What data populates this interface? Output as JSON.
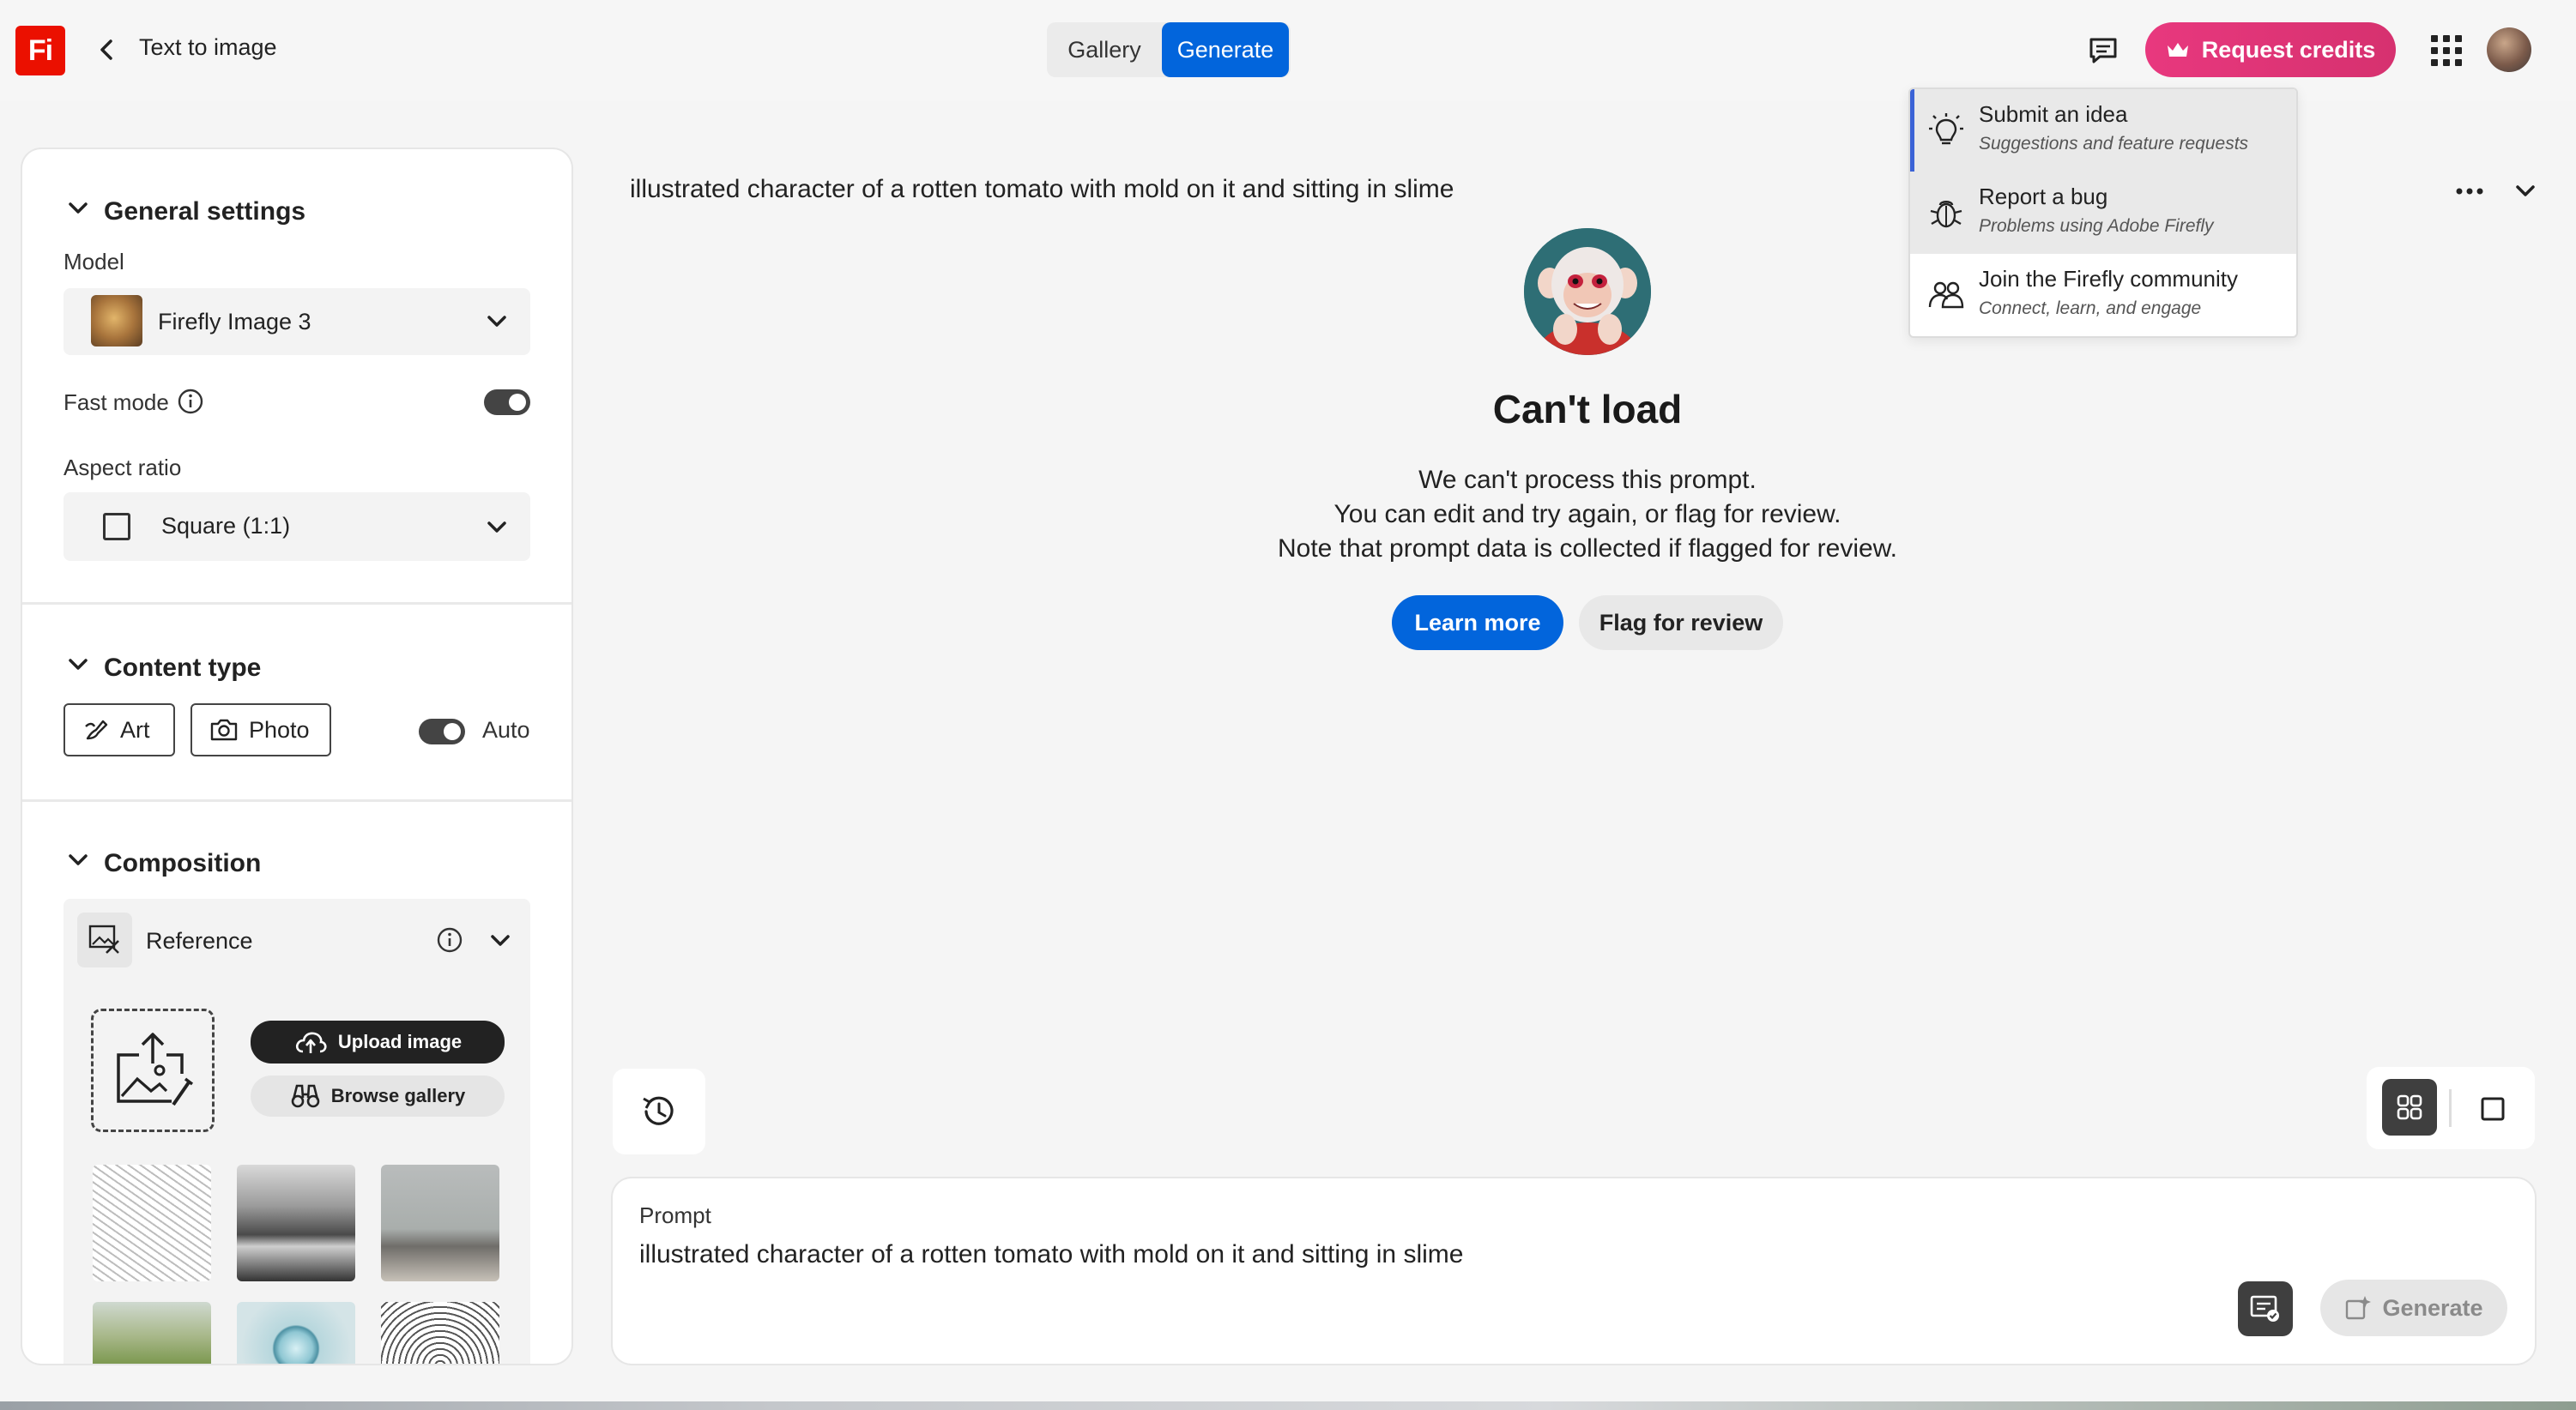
{
  "header": {
    "logo_text": "Fi",
    "page_title": "Text to image",
    "tabs": [
      {
        "label": "Gallery"
      },
      {
        "label": "Generate"
      }
    ],
    "request_credits_label": "Request credits"
  },
  "left_panel": {
    "general_settings": {
      "title": "General settings",
      "model_label": "Model",
      "model_value": "Firefly Image 3",
      "fast_mode_label": "Fast mode",
      "fast_mode_on": true,
      "aspect_ratio_label": "Aspect ratio",
      "aspect_ratio_value": "Square (1:1)"
    },
    "content_type": {
      "title": "Content type",
      "options": [
        {
          "label": "Art"
        },
        {
          "label": "Photo"
        }
      ],
      "auto_label": "Auto",
      "auto_on": true
    },
    "composition": {
      "title": "Composition",
      "reference_label": "Reference",
      "upload_label": "Upload image",
      "browse_label": "Browse gallery"
    }
  },
  "main": {
    "prompt_heading": "illustrated character of a rotten tomato with mold on it and sitting in slime",
    "error_title": "Can't load",
    "error_lines": [
      "We can't process this prompt.",
      "You can edit and try again, or flag for review.",
      "Note that prompt data is collected if flagged for review."
    ],
    "learn_more_label": "Learn more",
    "flag_label": "Flag for review",
    "prompt_label": "Prompt",
    "prompt_value": "illustrated character of a rotten tomato with mold on it and sitting in slime",
    "generate_label": "Generate"
  },
  "feedback_menu": {
    "items": [
      {
        "title": "Submit an idea",
        "subtitle": "Suggestions and feature requests",
        "icon": "lightbulb-icon"
      },
      {
        "title": "Report a bug",
        "subtitle": "Problems using Adobe Firefly",
        "icon": "bug-icon"
      },
      {
        "title": "Join the Firefly community",
        "subtitle": "Connect, learn, and engage",
        "icon": "community-icon"
      }
    ]
  },
  "colors": {
    "accent_blue": "#0265dc",
    "credits_pink": "#e8387e",
    "logo_red": "#eb1000"
  }
}
